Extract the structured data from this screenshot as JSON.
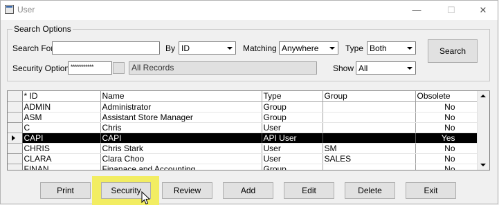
{
  "window": {
    "title": "User",
    "minimize_glyph": "—",
    "maximize_glyph": "☐",
    "close_glyph": "✕"
  },
  "search_options": {
    "legend": "Search Options",
    "search_for_label": "Search For",
    "search_for_value": "",
    "by_label": "By",
    "by_value": "ID",
    "matching_label": "Matching",
    "matching_value": "Anywhere",
    "type_label": "Type",
    "type_value": "Both",
    "search_button": "Search",
    "security_option_label": "Security Option",
    "security_option_value": "***********",
    "records_value": "All Records",
    "show_label": "Show",
    "show_value": "All"
  },
  "grid": {
    "columns": [
      "* ID",
      "Name",
      "Type",
      "Group",
      "Obsolete"
    ],
    "rows": [
      {
        "id": "ADMIN",
        "name": "Administrator",
        "type": "Group",
        "group": "",
        "obsolete": "No",
        "selected": false
      },
      {
        "id": "ASM",
        "name": "Assistant Store Manager",
        "type": "Group",
        "group": "",
        "obsolete": "No",
        "selected": false
      },
      {
        "id": "C",
        "name": "Chris",
        "type": "User",
        "group": "",
        "obsolete": "No",
        "selected": false
      },
      {
        "id": "CAPI",
        "name": "CAPI",
        "type": "API User",
        "group": "",
        "obsolete": "Yes",
        "selected": true
      },
      {
        "id": "CHRIS",
        "name": "Chris Stark",
        "type": "User",
        "group": "SM",
        "obsolete": "No",
        "selected": false
      },
      {
        "id": "CLARA",
        "name": "Clara Choo",
        "type": "User",
        "group": "SALES",
        "obsolete": "No",
        "selected": false
      },
      {
        "id": "FINAN",
        "name": "Finanace and Accounting",
        "type": "Group",
        "group": "",
        "obsolete": "No",
        "selected": false
      }
    ]
  },
  "buttons": {
    "print": "Print",
    "security": "Security",
    "review": "Review",
    "add": "Add",
    "edit": "Edit",
    "delete": "Delete",
    "exit": "Exit"
  },
  "colors": {
    "highlight": "#f2ed62",
    "selection": "#000000"
  },
  "icons": {
    "app": "user-window-icon",
    "cursor": "mouse-pointer-icon"
  }
}
